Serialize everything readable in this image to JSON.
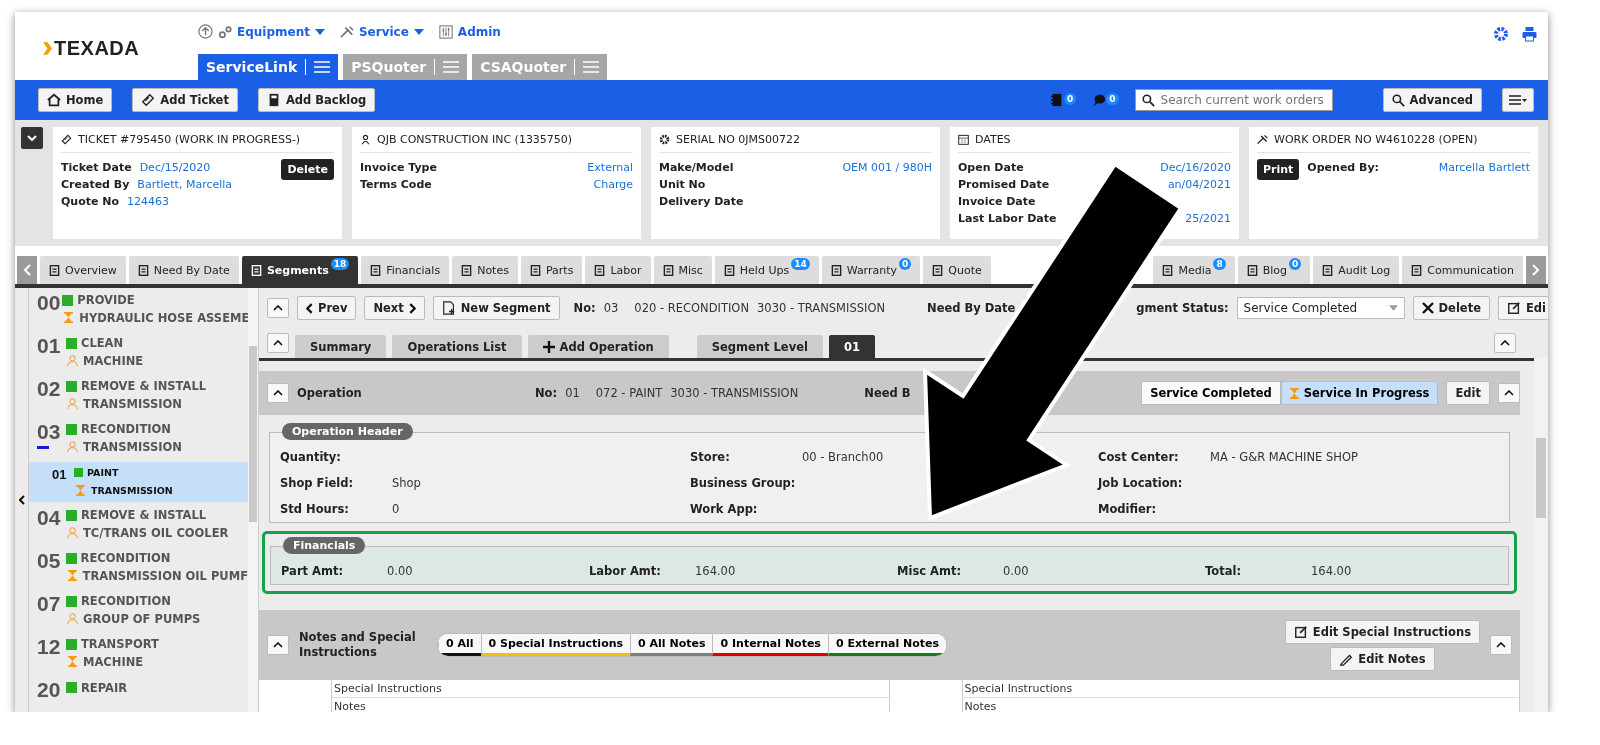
{
  "header": {
    "logo": "TEXADA",
    "nav": [
      {
        "label": "Equipment",
        "dropdown": true
      },
      {
        "label": "Service",
        "dropdown": true
      },
      {
        "label": "Admin",
        "dropdown": false
      }
    ],
    "products": [
      {
        "label": "ServiceLink",
        "selected": true
      },
      {
        "label": "PSQuoter",
        "selected": false
      },
      {
        "label": "CSAQuoter",
        "selected": false
      }
    ]
  },
  "toolbar": {
    "buttons": [
      "Home",
      "Add Ticket",
      "Add Backlog"
    ],
    "badges": [
      "0",
      "0"
    ],
    "search": {
      "placeholder": "Search current work orders"
    },
    "advanced": "Advanced"
  },
  "cards": [
    {
      "title": "TICKET #795450 (WORK IN PROGRESS-)",
      "button": "Delete",
      "rows": [
        {
          "label": "Ticket Date",
          "value": "Dec/15/2020"
        },
        {
          "label": "Created By",
          "value": "Bartlett, Marcella"
        },
        {
          "label": "Quote No",
          "value": "124463"
        }
      ]
    },
    {
      "title": "QJB CONSTRUCTION INC (1335750)",
      "rows": [
        {
          "label": "Invoice Type",
          "value": "External"
        },
        {
          "label": "Terms Code",
          "value": "Charge"
        }
      ]
    },
    {
      "title": "SERIAL NO 0JMS00722",
      "rows": [
        {
          "label": "Make/Model",
          "value": "OEM 001 / 980H"
        },
        {
          "label": "Unit No"
        },
        {
          "label": "Delivery Date"
        }
      ]
    },
    {
      "title": "DATES",
      "rows": [
        {
          "label": "Open Date",
          "value": "Dec/16/2020"
        },
        {
          "label": "Promised Date",
          "value": "an/04/2021"
        },
        {
          "label": "Invoice Date"
        },
        {
          "label": "Last Labor Date",
          "value": "25/2021"
        }
      ]
    },
    {
      "title": "WORK ORDER NO W4610228 (OPEN)",
      "button": "Print",
      "rows": [
        {
          "label": "Opened By:",
          "value": "Marcella Bartlett"
        }
      ]
    }
  ],
  "tabs": [
    {
      "label": "Overview",
      "selected": false
    },
    {
      "label": "Need By Date",
      "selected": false
    },
    {
      "label": "Segments",
      "badge": "18",
      "selected": true
    },
    {
      "label": "Financials",
      "selected": false
    },
    {
      "label": "Notes",
      "selected": false
    },
    {
      "label": "Parts",
      "selected": false
    },
    {
      "label": "Labor",
      "selected": false
    },
    {
      "label": "Misc",
      "selected": false
    },
    {
      "label": "Held Ups",
      "badge": "14",
      "selected": false
    },
    {
      "label": "Warranty",
      "badge": "0",
      "selected": false
    },
    {
      "label": "Quote",
      "selected": false
    },
    {
      "label": "Media",
      "badge": "8",
      "selected": false,
      "gap_before": true
    },
    {
      "label": "Blog",
      "badge": "0",
      "selected": false
    },
    {
      "label": "Audit Log",
      "selected": false
    },
    {
      "label": "Communication",
      "selected": false
    }
  ],
  "segments": [
    {
      "number": "00",
      "line1": "PROVIDE",
      "line2": "HYDRAULIC HOSE ASSEME",
      "kind": "hourglass",
      "expanded": false
    },
    {
      "number": "01",
      "line1": "CLEAN",
      "line2": "MACHINE",
      "kind": "person",
      "expanded": false
    },
    {
      "number": "02",
      "line1": "REMOVE & INSTALL",
      "line2": "TRANSMISSION",
      "kind": "person",
      "expanded": false
    },
    {
      "number": "03",
      "line1": "RECONDITION",
      "line2": "TRANSMISSION",
      "kind": "person",
      "expanded": true,
      "children": [
        {
          "number": "01",
          "line1": "PAINT",
          "line2": "TRANSMISSION",
          "kind": "hourglass",
          "selected": true
        }
      ]
    },
    {
      "number": "04",
      "line1": "REMOVE & INSTALL",
      "line2": "TC/TRANS OIL COOLER",
      "kind": "person",
      "expanded": false
    },
    {
      "number": "05",
      "line1": "RECONDITION",
      "line2": "TRANSMISSION OIL PUMF",
      "kind": "hourglass",
      "expanded": false
    },
    {
      "number": "07",
      "line1": "RECONDITION",
      "line2": "GROUP OF PUMPS",
      "kind": "person",
      "expanded": false
    },
    {
      "number": "12",
      "line1": "TRANSPORT",
      "line2": "MACHINE",
      "kind": "hourglass",
      "expanded": false
    },
    {
      "number": "20",
      "line1": "REPAIR",
      "expanded": false
    }
  ],
  "segment_bar": {
    "prev": "Prev",
    "next": "Next",
    "new": "New Segment",
    "no_label": "No:",
    "no": "03",
    "job": "020 - RECONDITION",
    "component": "3030 - TRANSMISSION",
    "need_by": "Need By Date",
    "status_label": "gment Status:",
    "status": "Service Completed",
    "delete": "Delete",
    "edit": "Edi"
  },
  "subtabs": [
    {
      "label": "Summary",
      "selected": false
    },
    {
      "label": "Operations List",
      "selected": false
    },
    {
      "label": "Add Operation",
      "selected": false,
      "kind": "add"
    },
    {
      "label": "Segment Level",
      "selected": false,
      "kind": "plain"
    },
    {
      "label": "01",
      "selected": true
    }
  ],
  "operation": {
    "title": "Operation",
    "no_label": "No:",
    "no": "01",
    "job": "072 - PAINT",
    "component": "3030 - TRANSMISSION",
    "need_by": "Need B",
    "states": [
      {
        "label": "Service Completed",
        "selected": false
      },
      {
        "label": "Service In Progress",
        "selected": true
      }
    ],
    "edit": "Edit"
  },
  "operation_header": {
    "title": "Operation Header",
    "fields": [
      {
        "label": "Quantity:"
      },
      {
        "label": "Store:",
        "value": "00 - Branch00"
      },
      {
        "label": "Cost Center:",
        "value": "MA - G&R MACHINE SHOP"
      },
      {
        "label": "Shop Field:",
        "value": "Shop"
      },
      {
        "label": "Business Group:"
      },
      {
        "label": "Job Location:"
      },
      {
        "label": "Std Hours:",
        "value": "0"
      },
      {
        "label": "Work App:"
      },
      {
        "label": "Modifier:"
      }
    ]
  },
  "financials": {
    "title": "Financials",
    "highlighted": true,
    "fields": [
      {
        "label": "Part Amt:",
        "value": "0.00"
      },
      {
        "label": "Labor Amt:",
        "value": "164.00"
      },
      {
        "label": "Misc Amt:",
        "value": "0.00"
      },
      {
        "label": "Total:",
        "value": "164.00"
      }
    ]
  },
  "notes": {
    "title": "Notes and Special Instructions",
    "filters": [
      {
        "label": "0 All",
        "color": "#111111"
      },
      {
        "label": "0 Special Instructions",
        "color": "#f2c200"
      },
      {
        "label": "0 All Notes",
        "color": "#808080"
      },
      {
        "label": "0 Internal Notes",
        "color": "#e00000"
      },
      {
        "label": "0 External Notes",
        "color": "#1a7a1a"
      }
    ],
    "buttons": [
      "Edit Special Instructions",
      "Edit Notes"
    ],
    "table_columns": [
      [
        "Special Instructions",
        "Notes"
      ],
      [
        "Special Instructions",
        "Notes"
      ]
    ]
  }
}
